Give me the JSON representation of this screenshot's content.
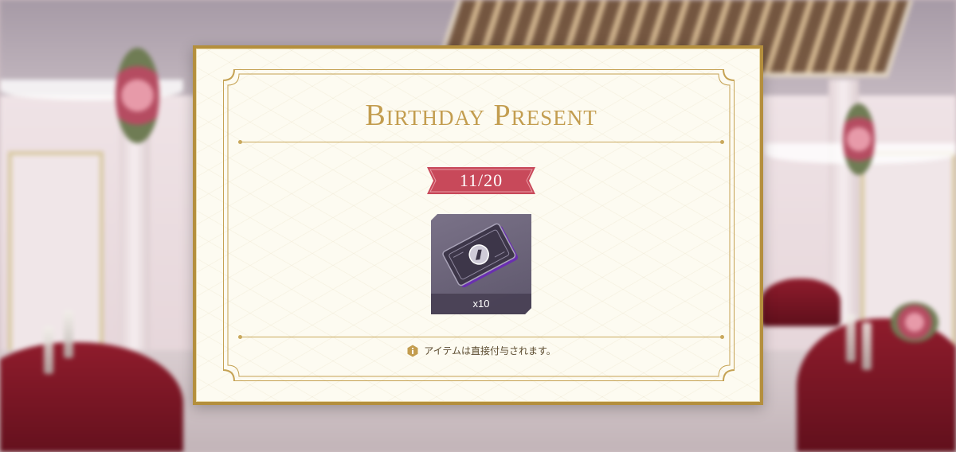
{
  "dialog": {
    "title": "Birthday Present",
    "date": "11/20",
    "reward": {
      "icon": "ticket-item-icon",
      "quantity": "x10"
    },
    "note_icon": "info-icon",
    "note": "アイテムは直接付与されます。"
  },
  "colors": {
    "gold": "#c39d4f",
    "ribbon": "#c8495a",
    "card_bg": "#fdfbf1"
  }
}
